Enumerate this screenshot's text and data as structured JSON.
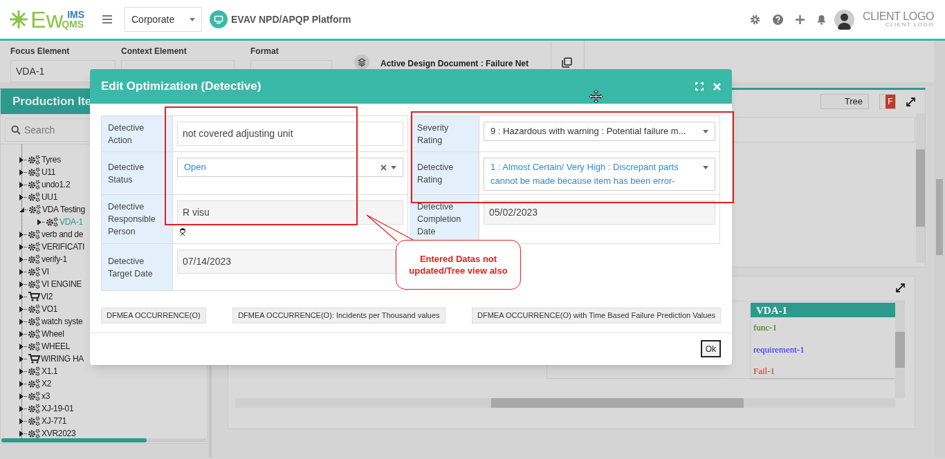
{
  "header": {
    "brand_main": "Ew",
    "brand_top": "IMS",
    "brand_bottom": "QMS",
    "org_select": "Corporate",
    "platform": "EVAV NPD/APQP Platform",
    "client_logo": "CLIENT LOGO",
    "client_logo_sub": "CLIENT LOGO"
  },
  "toolbar": {
    "focus_label": "Focus Element",
    "focus_value": "VDA-1",
    "context_label": "Context Element",
    "format_label": "Format",
    "active_doc": "Active Design Document : Failure Net"
  },
  "left_panel": {
    "title": "Production Ite",
    "search_placeholder": "Search",
    "tree": [
      {
        "label": "Tyres",
        "kind": "gear",
        "expanded": false,
        "selected": false
      },
      {
        "label": "U11",
        "kind": "gear",
        "expanded": false,
        "selected": false
      },
      {
        "label": "undo1.2",
        "kind": "gear",
        "expanded": false,
        "selected": false
      },
      {
        "label": "UU1",
        "kind": "gear",
        "expanded": false,
        "selected": false
      },
      {
        "label": "VDA Testing",
        "kind": "gear",
        "expanded": true,
        "selected": false,
        "children": [
          {
            "label": "VDA-1",
            "kind": "gear",
            "expanded": false,
            "selected": true
          }
        ]
      },
      {
        "label": "verb and de",
        "kind": "gear",
        "expanded": false,
        "selected": false
      },
      {
        "label": "VERIFICATI",
        "kind": "gear",
        "expanded": false,
        "selected": false
      },
      {
        "label": "verify-1",
        "kind": "gear",
        "expanded": false,
        "selected": false
      },
      {
        "label": "VI",
        "kind": "gear",
        "expanded": false,
        "selected": false
      },
      {
        "label": "VI ENGINE",
        "kind": "gear",
        "expanded": false,
        "selected": false
      },
      {
        "label": "VI2",
        "kind": "cart",
        "expanded": false,
        "selected": false
      },
      {
        "label": "VO1",
        "kind": "gear",
        "expanded": false,
        "selected": false
      },
      {
        "label": "watch syste",
        "kind": "gear",
        "expanded": false,
        "selected": false
      },
      {
        "label": "Wheel",
        "kind": "gear",
        "expanded": false,
        "selected": false
      },
      {
        "label": "WHEEL",
        "kind": "gear",
        "expanded": false,
        "selected": false
      },
      {
        "label": "WIRING HA",
        "kind": "cart",
        "expanded": false,
        "selected": false
      },
      {
        "label": "X1.1",
        "kind": "gear",
        "expanded": false,
        "selected": false
      },
      {
        "label": "X2",
        "kind": "gear",
        "expanded": false,
        "selected": false
      },
      {
        "label": "x3",
        "kind": "gear",
        "expanded": false,
        "selected": false
      },
      {
        "label": "XJ-19-01",
        "kind": "gear",
        "expanded": false,
        "selected": false
      },
      {
        "label": "XJ-771",
        "kind": "gear",
        "expanded": false,
        "selected": false
      },
      {
        "label": "XVR2023",
        "kind": "gear",
        "expanded": false,
        "selected": false
      }
    ]
  },
  "top_panel": {
    "view_toggle": "Tree",
    "flag_button": "F"
  },
  "node_card": {
    "title": "VDA-1",
    "items": [
      {
        "label": "func-1",
        "color": "#2e6b00"
      },
      {
        "label": "requirement-1",
        "color": "#1a1aff"
      },
      {
        "label": "Fail-1",
        "color": "#e0201b"
      }
    ]
  },
  "dialog": {
    "title": "Edit Optimization (Detective)",
    "left_fields": [
      {
        "label": "Detective Action",
        "value": "not covered adjusting unit",
        "kind": "text"
      },
      {
        "label": "Detective Status",
        "value": "Open",
        "kind": "select",
        "clearable": true
      },
      {
        "label": "Detective Responsible Person",
        "value": "R visu",
        "kind": "readonly",
        "person_icon": true
      },
      {
        "label": "Detective Target Date",
        "value": "07/14/2023",
        "kind": "readonly"
      }
    ],
    "right_fields": [
      {
        "label": "Severity Rating",
        "value": "9 : Hazardous with warning : Potential failure m...",
        "kind": "select"
      },
      {
        "label": "Detective Rating",
        "value": "1 : Almost Certain/ Very High : Discrepant parts cannot be made because item has been error-",
        "kind": "select"
      },
      {
        "label": "Detective Completion Date",
        "value": "05/02/2023",
        "kind": "readonly"
      }
    ],
    "buttons": [
      "DFMEA OCCURRENCE(O)",
      "DFMEA OCCURRENCE(O): Incidents per Thousand values",
      "DFMEA OCCURRENCE(O) with Time Based Failure Prediction Values"
    ],
    "ok": "Ok"
  },
  "annotation": {
    "text": "Entered Datas not updated/Tree view also"
  }
}
